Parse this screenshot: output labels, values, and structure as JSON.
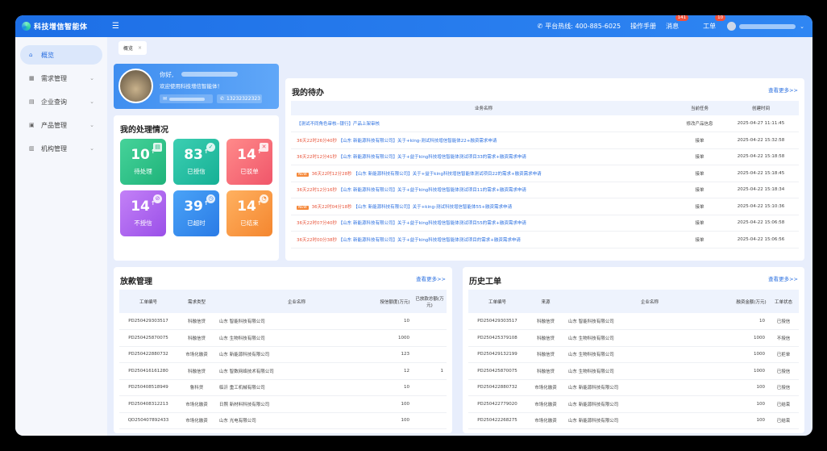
{
  "app": {
    "title": "科技增信智能体"
  },
  "topbar": {
    "hotline": "平台热线: 400-885-6025",
    "manual": "操作手册",
    "messages": "消息",
    "messages_badge": "141",
    "tickets": "工单",
    "tickets_badge": "10"
  },
  "sidebar": {
    "items": [
      {
        "label": "概览",
        "icon": "home-icon"
      },
      {
        "label": "需求管理",
        "icon": "grid-icon"
      },
      {
        "label": "企业查询",
        "icon": "document-icon"
      },
      {
        "label": "产品管理",
        "icon": "briefcase-icon"
      },
      {
        "label": "机构管理",
        "icon": "bank-icon"
      }
    ]
  },
  "tabs": {
    "overview": "概览"
  },
  "welcome": {
    "greeting": "你好,",
    "text": "欢迎使用科技增信智能体！",
    "phone": "13232322323"
  },
  "stats": {
    "title": "我的处理情况",
    "tiles": [
      {
        "num": "10",
        "label": "待处理",
        "color": "green"
      },
      {
        "num": "83",
        "label": "已授信",
        "color": "teal"
      },
      {
        "num": "14",
        "label": "已驳单",
        "color": "red"
      },
      {
        "num": "14",
        "label": "不授信",
        "color": "purple"
      },
      {
        "num": "39",
        "label": "已超时",
        "color": "blue"
      },
      {
        "num": "14",
        "label": "已结束",
        "color": "orange"
      }
    ]
  },
  "todo": {
    "title": "我的待办",
    "more": "查看更多>>",
    "headers": [
      "业务名称",
      "当前任务",
      "创建时间"
    ],
    "rows": [
      {
        "new": false,
        "prefix": "",
        "text": "【测试不同角色审核--银行】产品上架审核",
        "task": "修改产品信息",
        "time": "2025-04-27 11:11:45"
      },
      {
        "new": false,
        "prefix": "36天22时26分40秒",
        "text": "【山东 新能源科技有限公司】关于+king-测试科技增信智能体22+融资需求申请",
        "task": "接单",
        "time": "2025-04-22 15:32:58"
      },
      {
        "new": false,
        "prefix": "36天22时12分41秒",
        "text": "【山东 新能源科技有限公司】关于+益于king科技增信智能体测试项目33的需求+融资需求申请",
        "task": "接单",
        "time": "2025-04-22 15:18:58"
      },
      {
        "new": true,
        "prefix": "36天22时12分28秒",
        "text": "【山东 新能源科技有限公司】关于+益于king科技增信智能体测试项目22的需求+融资需求申请",
        "task": "接单",
        "time": "2025-04-22 15:18:45"
      },
      {
        "new": false,
        "prefix": "36天22时12分16秒",
        "text": "【山东 新能源科技有限公司】关于+益于king科技增信智能体测试项目11的需求+融资需求申请",
        "task": "接单",
        "time": "2025-04-22 15:18:34"
      },
      {
        "new": true,
        "prefix": "36天22时04分18秒",
        "text": "【山东 新能源科技有限公司】关于+king-测试科技增信智能体55+融资需求申请",
        "task": "接单",
        "time": "2025-04-22 15:10:36"
      },
      {
        "new": false,
        "prefix": "36天22时07分40秒",
        "text": "【山东 新能源科技有限公司】关于+益于king科技增信智能体测试项目55的需求+融资需求申请",
        "task": "接单",
        "time": "2025-04-22 15:06:58"
      },
      {
        "new": false,
        "prefix": "36天22时00分38秒",
        "text": "【山东 新能源科技有限公司】关于+益于king科技增信智能体测试项目的需求+融资需求申请",
        "task": "接单",
        "time": "2025-04-22 15:06:56"
      }
    ]
  },
  "loans": {
    "title": "放款管理",
    "more": "查看更多>>",
    "headers": [
      "工单编号",
      "需求类型",
      "企业名称",
      "授信额度(万元)",
      "已放款总额(万元)"
    ],
    "rows": [
      {
        "id": "PD250429303517",
        "type": "科融信贷",
        "co": "山东 智能科技有限公司",
        "credit": "10",
        "paid": ""
      },
      {
        "id": "PD250425870075",
        "type": "科融信贷",
        "co": "山东 生物科技有限公司",
        "credit": "1000",
        "paid": ""
      },
      {
        "id": "PD250422880732",
        "type": "市场化融资",
        "co": "山东 新能源科技有限公司",
        "credit": "123",
        "paid": ""
      },
      {
        "id": "PD250416161280",
        "type": "科融信贷",
        "co": "山东 智数网络技术有限公司",
        "credit": "12",
        "paid": "1"
      },
      {
        "id": "PD250408518949",
        "type": "鲁科贷",
        "co": "临沂 重工机械有限公司",
        "credit": "10",
        "paid": ""
      },
      {
        "id": "PD250408312213",
        "type": "市场化融资",
        "co": "日照 新材料科技有限公司",
        "credit": "100",
        "paid": ""
      },
      {
        "id": "QD250407892433",
        "type": "市场化融资",
        "co": "山东 光电有限公司",
        "credit": "100",
        "paid": ""
      }
    ]
  },
  "history": {
    "title": "历史工单",
    "more": "查看更多>>",
    "headers": [
      "工单编号",
      "来源",
      "企业名称",
      "融资金额(万元)",
      "工单状态"
    ],
    "rows": [
      {
        "id": "PD250429303517",
        "src": "科融信贷",
        "co": "山东 智能科技有限公司",
        "amt": "10",
        "status": "已授信"
      },
      {
        "id": "PD250425379108",
        "src": "科融信贷",
        "co": "山东 生物科技有限公司",
        "amt": "1000",
        "status": "不授信"
      },
      {
        "id": "PD250429132199",
        "src": "科融信贷",
        "co": "山东 生物科技有限公司",
        "amt": "1000",
        "status": "已拒单"
      },
      {
        "id": "PD250425870075",
        "src": "科融信贷",
        "co": "山东 生物科技有限公司",
        "amt": "1000",
        "status": "已授信"
      },
      {
        "id": "PD250422880732",
        "src": "市场化融资",
        "co": "山东 新能源科技有限公司",
        "amt": "100",
        "status": "已授信"
      },
      {
        "id": "PD250422779020",
        "src": "市场化融资",
        "co": "山东 新能源科技有限公司",
        "amt": "100",
        "status": "已结束"
      },
      {
        "id": "PD250422268275",
        "src": "市场化融资",
        "co": "山东 新能源科技有限公司",
        "amt": "100",
        "status": "已结束"
      }
    ]
  }
}
